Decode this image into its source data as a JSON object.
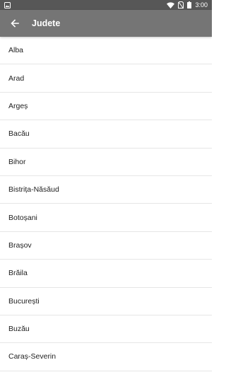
{
  "status_bar": {
    "time": "3:00",
    "icons": [
      "image-notification-icon",
      "wifi-icon",
      "no-sim-icon",
      "battery-icon"
    ]
  },
  "app_bar": {
    "back_icon": "arrow-back-icon",
    "title": "Judete",
    "background": "#757575",
    "text_color": "#ffffff"
  },
  "list": {
    "items": [
      {
        "label": "Alba"
      },
      {
        "label": "Arad"
      },
      {
        "label": "Argeș"
      },
      {
        "label": "Bacău"
      },
      {
        "label": "Bihor"
      },
      {
        "label": "Bistrița-Năsăud"
      },
      {
        "label": "Botoșani"
      },
      {
        "label": "Brașov"
      },
      {
        "label": "Brăila"
      },
      {
        "label": "București"
      },
      {
        "label": "Buzău"
      },
      {
        "label": "Caraș-Severin"
      }
    ]
  }
}
